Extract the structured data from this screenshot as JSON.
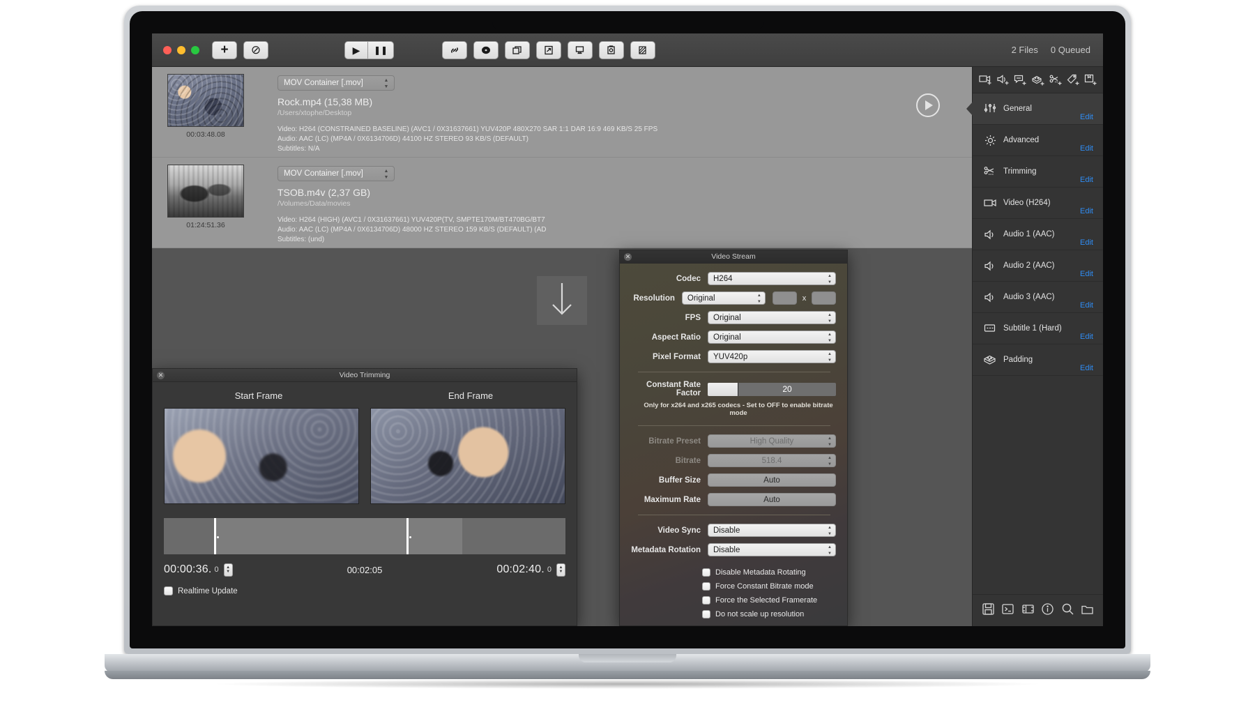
{
  "app": {
    "toolbar": {
      "add_label": "+",
      "cancel_label": "⊘",
      "play_label": "▶",
      "pause_label": "❚❚",
      "status_files": "2 Files",
      "status_queued": "0 Queued",
      "mid_icons": [
        {
          "name": "link-icon",
          "glyph": "🔗"
        },
        {
          "name": "disc-icon",
          "glyph": "⬤"
        },
        {
          "name": "copy-icon",
          "glyph": "❐"
        },
        {
          "name": "export-icon",
          "glyph": "↗"
        },
        {
          "name": "monitor-icon",
          "glyph": "🖵"
        },
        {
          "name": "snapshot-icon",
          "glyph": "▣"
        },
        {
          "name": "filter-icon",
          "glyph": "▨"
        }
      ]
    },
    "files": [
      {
        "container": "MOV Container [.mov]",
        "name": "Rock.mp4  (15,38 MB)",
        "path": "/Users/xtophe/Desktop",
        "duration": "00:03:48.08",
        "video": "Video: H264 (CONSTRAINED BASELINE) (AVC1 / 0X31637661)   YUV420P  480X270  SAR 1:1 DAR 16:9  469 KB/S  25 FPS",
        "audio": "Audio: AAC (LC) (MP4A / 0X6134706D)  44100 HZ  STEREO  93 KB/S (DEFAULT)",
        "subtitles": "Subtitles: N/A"
      },
      {
        "container": "MOV Container [.mov]",
        "name": "TSOB.m4v  (2,37 GB)",
        "path": "/Volumes/Data/movies",
        "duration": "01:24:51.36",
        "video": "Video: H264 (HIGH) (AVC1 / 0X31637661)   YUV420P(TV, SMPTE170M/BT470BG/BT7",
        "audio": "Audio: AAC (LC) (MP4A / 0X6134706D)  48000 HZ  STEREO  159 KB/S (DEFAULT) (AD",
        "subtitles": "Subtitles: (und)"
      }
    ],
    "trimming_panel": {
      "title": "Video Trimming",
      "start_head": "Start Frame",
      "end_head": "End Frame",
      "start_time": "00:00:36.",
      "start_sub": "0",
      "mid_time": "00:02:05",
      "end_time": "00:02:40.",
      "end_sub": "0",
      "realtime_label": "Realtime Update"
    },
    "video_stream_panel": {
      "title": "Video Stream",
      "rows": [
        {
          "label": "Codec",
          "value": "H264"
        },
        {
          "label": "Resolution",
          "value": "Original"
        },
        {
          "label": "FPS",
          "value": "Original"
        },
        {
          "label": "Aspect Ratio",
          "value": "Original"
        },
        {
          "label": "Pixel Format",
          "value": "YUV420p"
        }
      ],
      "res_x_label": "x",
      "crf_label": "Constant Rate Factor",
      "crf_value": "20",
      "crf_note": "Only for x264 and x265 codecs  -  Set to OFF to enable bitrate mode",
      "bitrate_preset_label": "Bitrate Preset",
      "bitrate_preset_value": "High Quality",
      "bitrate_label": "Bitrate",
      "bitrate_value": "518.4",
      "buffer_label": "Buffer Size",
      "buffer_value": "Auto",
      "maxrate_label": "Maximum Rate",
      "maxrate_value": "Auto",
      "videosync_label": "Video Sync",
      "videosync_value": "Disable",
      "metarot_label": "Metadata Rotation",
      "metarot_value": "Disable",
      "checkboxes": [
        "Disable Metadata Rotating",
        "Force Constant Bitrate mode",
        "Force the Selected Framerate",
        "Do not scale up resolution"
      ]
    },
    "sidebar": {
      "add_icons": [
        "add-video-icon",
        "add-audio-icon",
        "add-subtitle-icon",
        "add-padding-icon",
        "add-trimming-icon",
        "add-tag-icon",
        "add-chapter-icon"
      ],
      "edit_label": "Edit",
      "items": [
        {
          "label": "General",
          "icon": "sliders-icon",
          "active": true
        },
        {
          "label": "Advanced",
          "icon": "gear-icon",
          "active": false
        },
        {
          "label": "Trimming",
          "icon": "scissors-icon",
          "active": false
        },
        {
          "label": "Video (H264)",
          "icon": "camera-icon",
          "active": false
        },
        {
          "label": "Audio 1 (AAC)",
          "icon": "speaker-icon",
          "active": false
        },
        {
          "label": "Audio 2 (AAC)",
          "icon": "speaker-icon",
          "active": false
        },
        {
          "label": "Audio 3 (AAC)",
          "icon": "speaker-icon",
          "active": false
        },
        {
          "label": "Subtitle 1 (Hard)",
          "icon": "subtitle-icon",
          "active": false
        },
        {
          "label": "Padding",
          "icon": "padding-icon",
          "active": false
        }
      ],
      "bottom_icons": [
        "save-icon",
        "terminal-icon",
        "film-icon",
        "info-icon",
        "search-icon",
        "folder-icon"
      ]
    },
    "colors": {
      "accent": "#2f8df5",
      "panel": "#383838",
      "window": "#3a3a3a"
    }
  }
}
